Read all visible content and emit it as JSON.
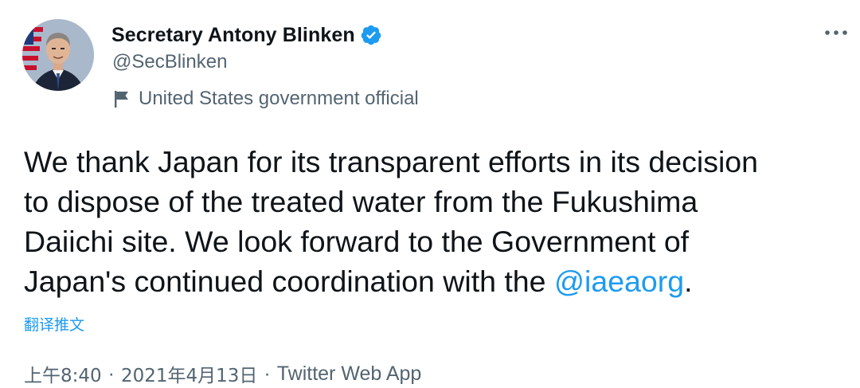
{
  "user": {
    "display_name": "Secretary Antony Blinken",
    "handle": "@SecBlinken",
    "label": "United States government official",
    "verified_icon": "verified-badge-icon",
    "label_icon": "flag-icon",
    "avatar_icon": "avatar"
  },
  "tweet": {
    "lines": [
      "We thank Japan for its transparent efforts in its decision",
      "to dispose of the treated water from the Fukushima",
      "Daiichi site. We look forward to the Government of",
      "Japan's continued coordination with the "
    ],
    "mention": "@iaeaorg",
    "mention_suffix": ".",
    "translate_label": "翻译推文"
  },
  "meta": {
    "time": "上午8:40",
    "separator": "·",
    "date": "2021年4月13日",
    "source": "Twitter Web App"
  },
  "colors": {
    "text": "#0f1419",
    "secondary": "#536471",
    "link": "#1d9bf0",
    "background": "#ffffff"
  },
  "more_icon": "more-options-icon"
}
